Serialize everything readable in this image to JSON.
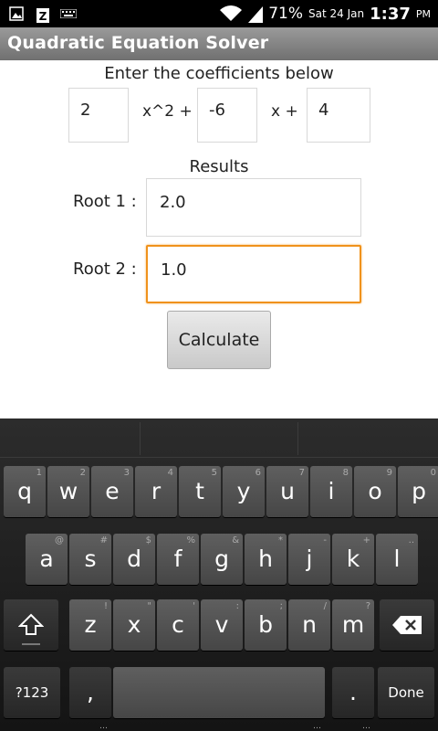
{
  "status_bar": {
    "battery_percent": "71%",
    "date": "Sat 24 Jan",
    "time": "1:37",
    "ampm": "PM"
  },
  "app": {
    "title": "Quadratic Equation Solver"
  },
  "form": {
    "prompt": "Enter the coefficients below",
    "coef_a": "2",
    "op_x2": "x^2 +",
    "coef_b": "-6",
    "op_x": "x +",
    "coef_c": "4",
    "results_label": "Results",
    "root1_label": "Root 1 :",
    "root1_value": "2.0",
    "root2_label": "Root 2 :",
    "root2_value": "1.0",
    "calculate_label": "Calculate"
  },
  "keyboard": {
    "row1": [
      {
        "k": "q",
        "h": "1"
      },
      {
        "k": "w",
        "h": "2"
      },
      {
        "k": "e",
        "h": "3"
      },
      {
        "k": "r",
        "h": "4"
      },
      {
        "k": "t",
        "h": "5"
      },
      {
        "k": "y",
        "h": "6"
      },
      {
        "k": "u",
        "h": "7"
      },
      {
        "k": "i",
        "h": "8"
      },
      {
        "k": "o",
        "h": "9"
      },
      {
        "k": "p",
        "h": "0"
      }
    ],
    "row2": [
      {
        "k": "a",
        "h": "@"
      },
      {
        "k": "s",
        "h": "#"
      },
      {
        "k": "d",
        "h": "$"
      },
      {
        "k": "f",
        "h": "%"
      },
      {
        "k": "g",
        "h": "&"
      },
      {
        "k": "h",
        "h": "*"
      },
      {
        "k": "j",
        "h": "-"
      },
      {
        "k": "k",
        "h": "+"
      },
      {
        "k": "l",
        "h": ".."
      }
    ],
    "row3": [
      {
        "k": "z",
        "h": "!"
      },
      {
        "k": "x",
        "h": "\""
      },
      {
        "k": "c",
        "h": "'"
      },
      {
        "k": "v",
        "h": ":"
      },
      {
        "k": "b",
        "h": ";"
      },
      {
        "k": "n",
        "h": "/"
      },
      {
        "k": "m",
        "h": "?"
      }
    ],
    "mode_key": "?123",
    "comma_key": ",",
    "period_key": ".",
    "done_key": "Done"
  },
  "icons": {
    "shift": "shift-icon",
    "backspace": "backspace-icon"
  },
  "colors": {
    "focus_border": "#f0921c",
    "titlebar": "#808080",
    "keyboard_bg": "#1e1e1e"
  }
}
